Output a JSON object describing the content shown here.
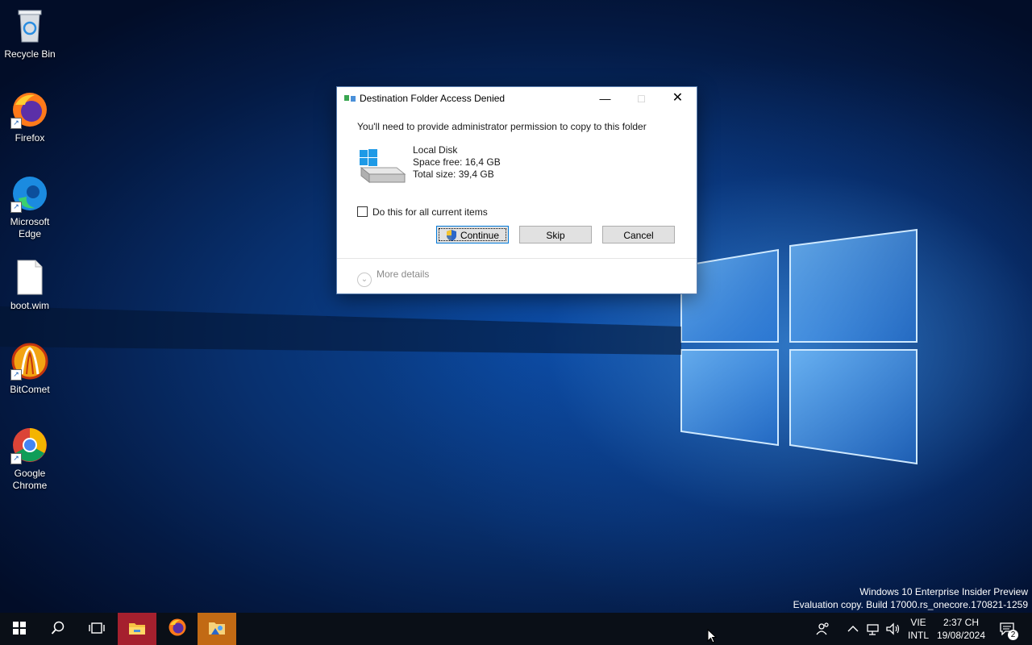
{
  "desktop": {
    "icons": [
      {
        "label": "Recycle Bin",
        "icon": "recycle-bin-icon"
      },
      {
        "label": "Firefox",
        "icon": "firefox-icon"
      },
      {
        "label": "Microsoft\nEdge",
        "label_line1": "Microsoft",
        "label_line2": "Edge",
        "icon": "edge-icon"
      },
      {
        "label": "boot.wim",
        "icon": "file-icon"
      },
      {
        "label": "BitComet",
        "icon": "bitcomet-icon"
      },
      {
        "label_line1": "Google",
        "label_line2": "Chrome",
        "icon": "chrome-icon"
      }
    ]
  },
  "dialog": {
    "title": "Destination Folder Access Denied",
    "message": "You'll need to provide administrator permission to copy to this folder",
    "disk": {
      "name": "Local Disk",
      "space_free": "Space free: 16,4 GB",
      "total_size": "Total size: 39,4 GB"
    },
    "checkbox_label": "Do this for all current items",
    "checkbox_checked": false,
    "buttons": {
      "continue": "Continue",
      "skip": "Skip",
      "cancel": "Cancel"
    },
    "more_details": "More details"
  },
  "watermark": {
    "line1": "Windows 10 Enterprise Insider Preview",
    "line2": "Evaluation copy. Build 17000.rs_onecore.170821-1259"
  },
  "taskbar": {
    "language": {
      "line1": "VIE",
      "line2": "INTL"
    },
    "clock": {
      "time": "2:37 CH",
      "date": "19/08/2024"
    },
    "notification_count": "2"
  },
  "colors": {
    "accent": "#0078d7",
    "taskbar": "#0a0f17",
    "explorer_active": "#a5202e",
    "app_active": "#c26a14"
  }
}
